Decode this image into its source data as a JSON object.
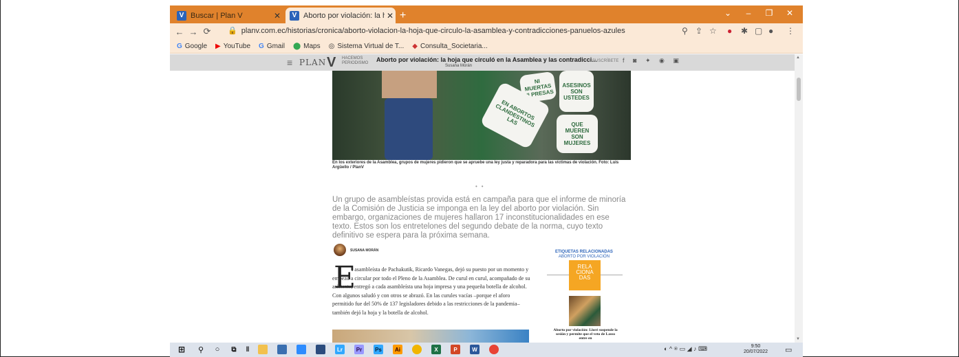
{
  "browser": {
    "tabs": [
      {
        "label": "Buscar | Plan V",
        "active": false
      },
      {
        "label": "Aborto por violación: la hoja que",
        "active": true
      }
    ],
    "url": "planv.com.ec/historias/cronica/aborto-violacion-la-hoja-que-circulo-la-asamblea-y-contradicciones-panuelos-azules",
    "bookmarks": [
      "Google",
      "YouTube",
      "Gmail",
      "Maps",
      "Sistema Virtual de T...",
      "Consulta_Societaria..."
    ],
    "accent": "#e0822c"
  },
  "site": {
    "brand": "PLAN",
    "brand_v": "V",
    "tagline": "HACEMOS PERIODISMO",
    "header_title": "Aborto por violación: la hoja que circuló en la Asamblea y las contradicci...",
    "header_author": "Susana Morán",
    "subscribe": "SUSCRÍBETE"
  },
  "article": {
    "photo_signs": [
      "ASESINOS SON USTEDES",
      "NI MUERTAS NI PRESAS",
      "QUE MUEREN SON MUJERES",
      "EN ABORTOS CLANDESTINOS LAS"
    ],
    "caption": "En los exteriores de la Asamblea, grupos de mujeres pidieron que se apruebe una ley justa y reparadora para las víctimas de violación. Foto: Luis Argüello / PlanV",
    "lead": "Un grupo de asambleístas provida está en campaña para que el informe de minoría de la Comisión de Justicia se imponga en la ley del aborto por violación. Sin embargo, organizaciones de mujeres hallaron 17 inconstitucionalidades en ese texto. Estos son los entretelones del segundo debate de la norma, cuyo texto definitivo se espera para la próxima semana.",
    "author": "SUSANA MORÁN",
    "dropcap": "E",
    "body": "l asambleísta de Pachakutik, Ricardo Vanegas, dejó su puesto por un momento y empezó a circular por todo el Pleno de la Asamblea. De curul en curul, acompañado de su asistente, entregó a cada asambleísta una hoja impresa y una pequeña botella de alcohol. Con algunos saludó y con otros se abrazó. En las curules vacías –porque el aforo permitido fue del 50% de 137 legisladores debido a las restricciones de la pandemia– también dejó la hoja y la botella de alcohol."
  },
  "sidebar": {
    "heading": "ETIQUETAS RELACIONADAS",
    "tag": "ABORTO POR VIOLACIÓN",
    "related_box": "RELA CIONA DAS",
    "related_caption": "Aborto por violación: Lloré suspende la sesión y permite que el veto de Lasso entre en"
  },
  "taskbar": {
    "time": "9:50",
    "date": "20/07/2022"
  }
}
